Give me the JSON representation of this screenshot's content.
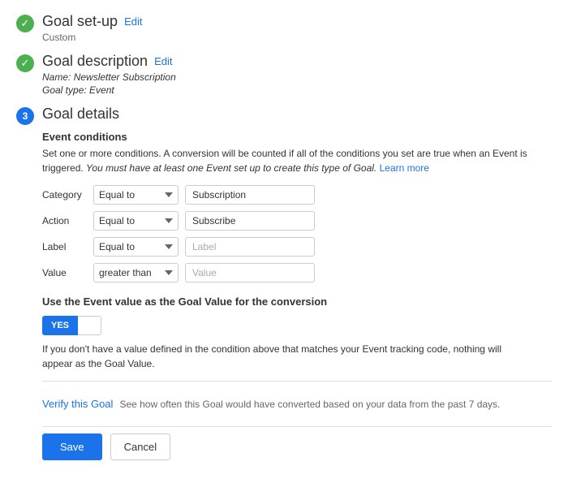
{
  "step1": {
    "title": "Goal set-up",
    "edit_label": "Edit",
    "subtitle": "Custom"
  },
  "step2": {
    "title": "Goal description",
    "edit_label": "Edit",
    "name_label": "Name:",
    "name_value": "Newsletter Subscription",
    "type_label": "Goal type:",
    "type_value": "Event"
  },
  "step3": {
    "number": "3",
    "title": "Goal details",
    "event_conditions": {
      "title": "Event conditions",
      "description_normal": "Set one or more conditions. A conversion will be counted if all of the conditions you set are true when an Event is triggered.",
      "description_italic": "You must have at least one Event set up to create this type of Goal.",
      "learn_more_label": "Learn more"
    },
    "conditions": [
      {
        "label": "Category",
        "operator": "Equal to",
        "value": "Subscription",
        "placeholder": "Subscription"
      },
      {
        "label": "Action",
        "operator": "Equal to",
        "value": "Subscribe",
        "placeholder": "Subscribe"
      },
      {
        "label": "Label",
        "operator": "Equal to",
        "value": "",
        "placeholder": "Label"
      },
      {
        "label": "Value",
        "operator": "greater than",
        "value": "",
        "placeholder": "Value"
      }
    ],
    "goal_value": {
      "title": "Use the Event value as the Goal Value for the conversion",
      "toggle_yes": "YES",
      "toggle_no": "",
      "description": "If you don't have a value defined in the condition above that matches your Event tracking code, nothing will appear as the Goal Value."
    },
    "verify": {
      "link_label": "Verify this Goal",
      "description": "See how often this Goal would have converted based on your data from the past 7 days."
    },
    "buttons": {
      "save_label": "Save",
      "cancel_label": "Cancel"
    }
  }
}
